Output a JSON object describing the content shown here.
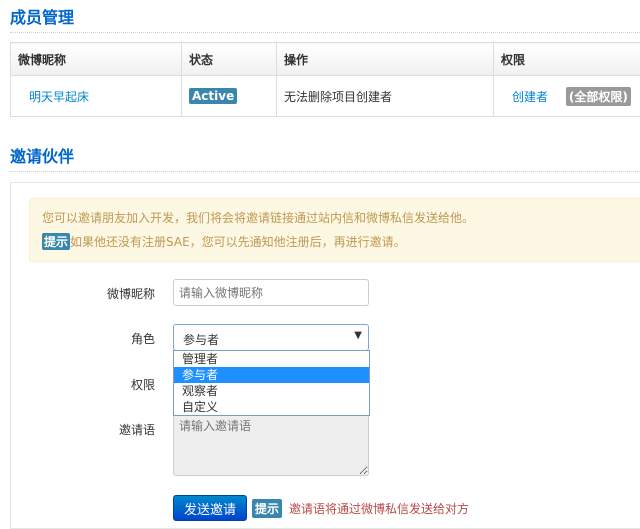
{
  "members": {
    "title": "成员管理",
    "headers": [
      "微博昵称",
      "状态",
      "操作",
      "权限"
    ],
    "rows": [
      {
        "nickname": "明天早起床",
        "status": "Active",
        "action": "无法删除项目创建者",
        "role": "创建者",
        "perm": "(全部权限)"
      }
    ]
  },
  "invite": {
    "title": "邀请伙伴",
    "alert_line1": "您可以邀请朋友加入开发，我们将会将邀请链接通过站内信和微博私信发送给他。",
    "alert_badge": "提示",
    "alert_line2": "如果他还没有注册SAE，您可以先通知他注册后，再进行邀请。",
    "nickname_label": "微博昵称",
    "nickname_placeholder": "请输入微博昵称",
    "role_label": "角色",
    "role_value": "参与者",
    "role_options": [
      "管理者",
      "参与者",
      "观察者",
      "自定义"
    ],
    "role_selected_index": 1,
    "perm_label": "权限",
    "message_label": "邀请语",
    "message_placeholder": "请输入邀请语",
    "send_label": "发送邀请",
    "hint_badge": "提示",
    "hint_text": "邀请语将通过微博私信发送给对方"
  },
  "colors": {
    "accent": "#0066cc",
    "badge": "#3a87ad",
    "selected": "#1e90ff",
    "danger": "#b94a48"
  }
}
